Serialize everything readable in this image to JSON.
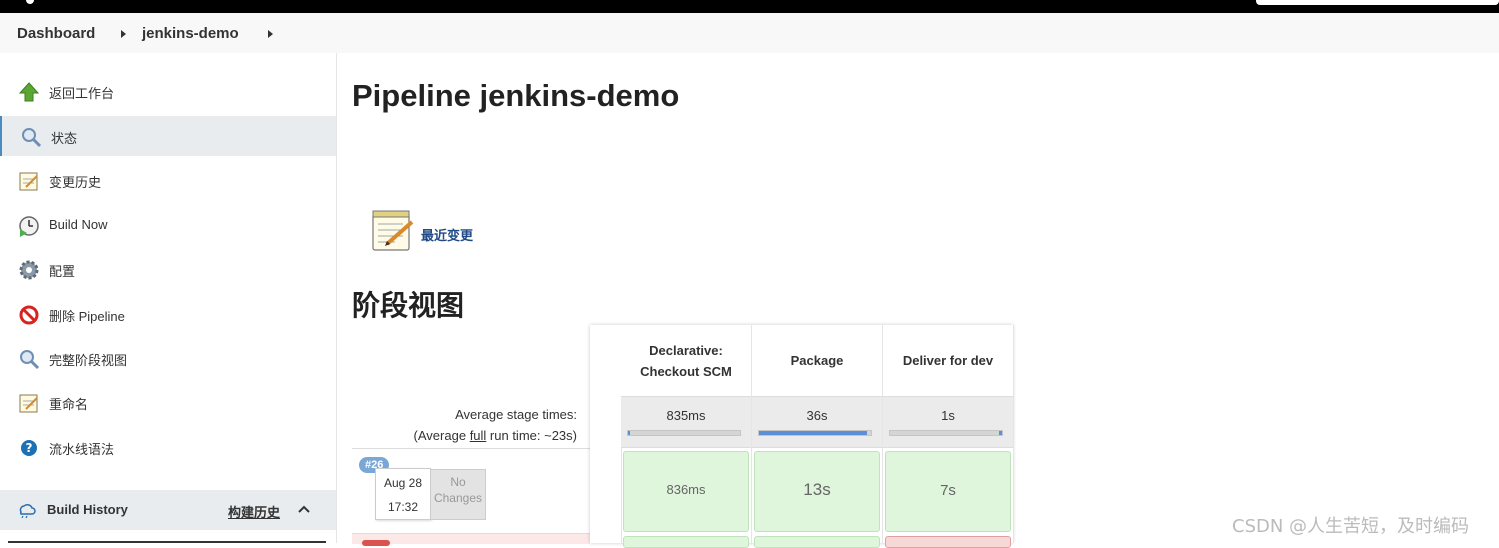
{
  "breadcrumb": {
    "items": [
      "Dashboard",
      "jenkins-demo"
    ]
  },
  "sidebar": {
    "items": [
      {
        "label": "返回工作台",
        "icon": "up-arrow-icon"
      },
      {
        "label": "状态",
        "icon": "magnifier-icon"
      },
      {
        "label": "变更历史",
        "icon": "notepad-icon"
      },
      {
        "label": "Build Now",
        "icon": "clock-build-icon"
      },
      {
        "label": "配置",
        "icon": "gear-icon"
      },
      {
        "label": "删除 Pipeline",
        "icon": "no-entry-icon"
      },
      {
        "label": "完整阶段视图",
        "icon": "magnifier-icon"
      },
      {
        "label": "重命名",
        "icon": "notepad-icon"
      },
      {
        "label": "流水线语法",
        "icon": "help-icon"
      }
    ],
    "active_index": 1,
    "build_history": {
      "title": "Build History",
      "link": "构建历史"
    }
  },
  "main": {
    "title": "Pipeline jenkins-demo",
    "recent_changes": "最近变更",
    "stage_view_title": "阶段视图"
  },
  "stage_view": {
    "avg_line1": "Average stage times:",
    "avg_line2_prefix": "(Average ",
    "avg_line2_link": "full",
    "avg_line2_suffix": " run time: ~23s)",
    "stages": [
      {
        "line1": "Declarative:",
        "line2": "Checkout SCM",
        "avg": "835ms",
        "avg_fraction": 0.01
      },
      {
        "line1": "Package",
        "line2": "",
        "avg": "36s",
        "avg_fraction": 0.96
      },
      {
        "line1": "Deliver for dev",
        "line2": "",
        "avg": "1s",
        "avg_fraction": 0.03
      }
    ],
    "runs": [
      {
        "number": "#26",
        "date": "Aug 28",
        "time": "17:32",
        "changes_line1": "No",
        "changes_line2": "Changes",
        "durations": [
          "836ms",
          "13s",
          "7s"
        ]
      }
    ]
  },
  "watermark": "CSDN @人生苦短，及时编码",
  "colors": {
    "accent": "#4b8bbe",
    "success_cell": "#dff5dc",
    "fail_cell": "#f8d7d7",
    "progress": "#5b8fd6"
  }
}
